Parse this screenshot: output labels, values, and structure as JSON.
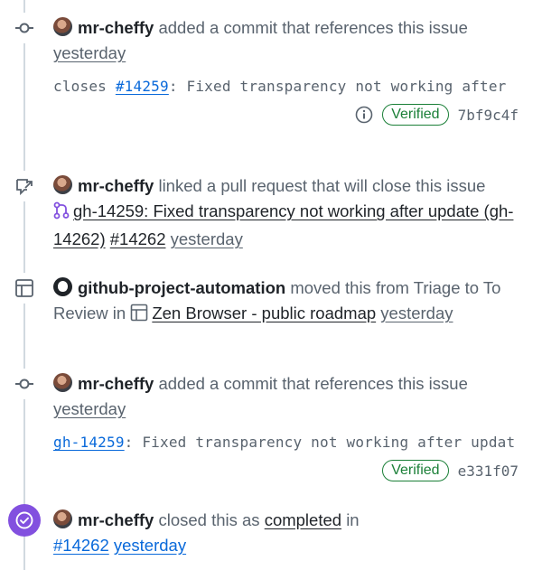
{
  "events": [
    {
      "actor": "mr-cheffy",
      "action": "added a commit that references this issue",
      "time": "yesterday",
      "commit_prefix": "closes ",
      "commit_ref": "#14259",
      "commit_rest": ": Fixed transparency not working after",
      "verified": "Verified",
      "sha": "7bf9c4f"
    },
    {
      "actor": "mr-cheffy",
      "action": "linked a pull request that will close this issue",
      "pr_title": "gh-14259: Fixed transparency not working after update (gh-14262)",
      "pr_number": "#14262",
      "time": "yesterday"
    },
    {
      "actor": "github-project-automation",
      "action": "moved this from Triage to To Review in",
      "project": "Zen Browser - public roadmap",
      "time": "yesterday"
    },
    {
      "actor": "mr-cheffy",
      "action": "added a commit that references this issue",
      "time": "yesterday",
      "commit_ref": "gh-14259",
      "commit_rest": ": Fixed transparency not working after updat",
      "verified": "Verified",
      "sha": "e331f07"
    },
    {
      "actor": "mr-cheffy",
      "action_before": "closed this as",
      "state": "completed",
      "action_after": "in",
      "ref": "#14262",
      "time": "yesterday"
    }
  ],
  "colors": {
    "closed_badge": "#8250df",
    "verified": "#1a7f37",
    "link": "#0969da",
    "pr_icon": "#8250df"
  }
}
